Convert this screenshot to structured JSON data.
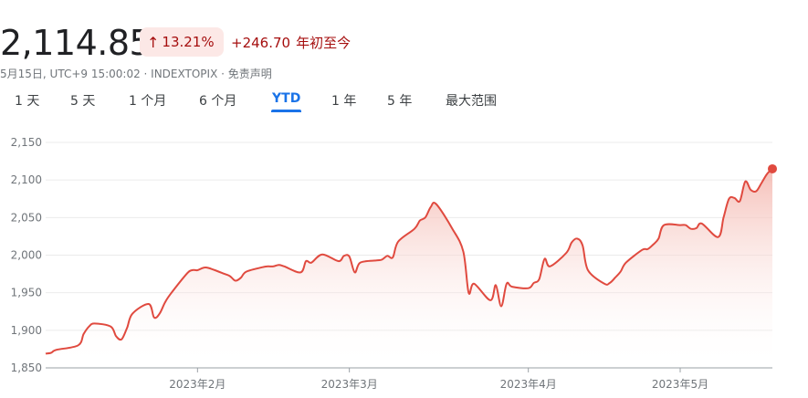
{
  "quote": {
    "price": "2,114.85",
    "percent_change": "13.21%",
    "abs_change": "+246.70",
    "period_label": "年初至今",
    "meta_text": "5月15日, UTC+9 15:00:02 · INDEXTOPIX · 免责声明",
    "up_arrow_icon": "arrow-up-icon"
  },
  "tabs": [
    {
      "label": "1 天"
    },
    {
      "label": "5 天"
    },
    {
      "label": "1 个月"
    },
    {
      "label": "6 个月"
    },
    {
      "label": "YTD",
      "active": true
    },
    {
      "label": "1 年"
    },
    {
      "label": "5 年"
    },
    {
      "label": "最大范围"
    }
  ],
  "colors": {
    "line": "#e04a3f",
    "fill_top": "#f4b8b0",
    "badge_bg": "#fce8e6",
    "negative_text": "#a50e0e",
    "accent": "#1a73e8"
  },
  "chart_data": {
    "type": "area",
    "x_axis": "date",
    "ylim": [
      1850,
      2150
    ],
    "yticks": [
      {
        "value": 1850,
        "label": "1,850"
      },
      {
        "value": 1900,
        "label": "1,900"
      },
      {
        "value": 1950,
        "label": "1,950"
      },
      {
        "value": 2000,
        "label": "2,000"
      },
      {
        "value": 2050,
        "label": "2,050"
      },
      {
        "value": 2100,
        "label": "2,100"
      },
      {
        "value": 2150,
        "label": "2,150"
      }
    ],
    "xticks": [
      {
        "date": "2023-02-01",
        "label": "2023年2月"
      },
      {
        "date": "2023-03-01",
        "label": "2023年3月"
      },
      {
        "date": "2023-04-03",
        "label": "2023年4月"
      },
      {
        "date": "2023-05-01",
        "label": "2023年5月"
      }
    ],
    "grid": "horizontal",
    "end_marker": true,
    "series": [
      {
        "points": [
          [
            "2023-01-04",
            1869
          ],
          [
            "2023-01-05",
            1870
          ],
          [
            "2023-01-06",
            1874
          ],
          [
            "2023-01-10",
            1880
          ],
          [
            "2023-01-11",
            1895
          ],
          [
            "2023-01-12",
            1905
          ],
          [
            "2023-01-13",
            1909
          ],
          [
            "2023-01-16",
            1905
          ],
          [
            "2023-01-17",
            1892
          ],
          [
            "2023-01-18",
            1888
          ],
          [
            "2023-01-19",
            1903
          ],
          [
            "2023-01-20",
            1922
          ],
          [
            "2023-01-23",
            1935
          ],
          [
            "2023-01-24",
            1917
          ],
          [
            "2023-01-25",
            1922
          ],
          [
            "2023-01-26",
            1937
          ],
          [
            "2023-01-27",
            1948
          ],
          [
            "2023-01-30",
            1975
          ],
          [
            "2023-01-31",
            1980
          ],
          [
            "2023-02-01",
            1980
          ],
          [
            "2023-02-02",
            1983
          ],
          [
            "2023-02-03",
            1983
          ],
          [
            "2023-02-06",
            1975
          ],
          [
            "2023-02-07",
            1972
          ],
          [
            "2023-02-08",
            1966
          ],
          [
            "2023-02-09",
            1970
          ],
          [
            "2023-02-10",
            1978
          ],
          [
            "2023-02-13",
            1984
          ],
          [
            "2023-02-14",
            1985
          ],
          [
            "2023-02-15",
            1985
          ],
          [
            "2023-02-16",
            1987
          ],
          [
            "2023-02-17",
            1985
          ],
          [
            "2023-02-20",
            1977
          ],
          [
            "2023-02-21",
            1992
          ],
          [
            "2023-02-22",
            1990
          ],
          [
            "2023-02-24",
            2001
          ],
          [
            "2023-02-27",
            1992
          ],
          [
            "2023-02-28",
            1999
          ],
          [
            "2023-03-01",
            1998
          ],
          [
            "2023-03-02",
            1977
          ],
          [
            "2023-03-03",
            1990
          ],
          [
            "2023-03-06",
            1993
          ],
          [
            "2023-03-07",
            1994
          ],
          [
            "2023-03-08",
            1999
          ],
          [
            "2023-03-09",
            1997
          ],
          [
            "2023-03-10",
            2018
          ],
          [
            "2023-03-13",
            2035
          ],
          [
            "2023-03-14",
            2046
          ],
          [
            "2023-03-15",
            2050
          ],
          [
            "2023-03-16",
            2064
          ],
          [
            "2023-03-17",
            2068
          ],
          [
            "2023-03-20",
            2035
          ],
          [
            "2023-03-22",
            2005
          ],
          [
            "2023-03-23",
            1950
          ],
          [
            "2023-03-24",
            1962
          ],
          [
            "2023-03-27",
            1940
          ],
          [
            "2023-03-28",
            1960
          ],
          [
            "2023-03-29",
            1932
          ],
          [
            "2023-03-30",
            1962
          ],
          [
            "2023-03-31",
            1958
          ],
          [
            "2023-04-03",
            1956
          ],
          [
            "2023-04-04",
            1963
          ],
          [
            "2023-04-05",
            1968
          ],
          [
            "2023-04-06",
            1995
          ],
          [
            "2023-04-07",
            1985
          ],
          [
            "2023-04-10",
            2003
          ],
          [
            "2023-04-11",
            2017
          ],
          [
            "2023-04-12",
            2022
          ],
          [
            "2023-04-13",
            2013
          ],
          [
            "2023-04-14",
            1980
          ],
          [
            "2023-04-17",
            1962
          ],
          [
            "2023-04-18",
            1963
          ],
          [
            "2023-04-19",
            1970
          ],
          [
            "2023-04-20",
            1978
          ],
          [
            "2023-04-21",
            1990
          ],
          [
            "2023-04-24",
            2007
          ],
          [
            "2023-04-25",
            2008
          ],
          [
            "2023-04-26",
            2014
          ],
          [
            "2023-04-27",
            2022
          ],
          [
            "2023-04-28",
            2040
          ],
          [
            "2023-05-01",
            2040
          ],
          [
            "2023-05-02",
            2040
          ],
          [
            "2023-05-03",
            2035
          ],
          [
            "2023-05-04",
            2036
          ],
          [
            "2023-05-05",
            2042
          ],
          [
            "2023-05-08",
            2024
          ],
          [
            "2023-05-09",
            2050
          ],
          [
            "2023-05-10",
            2075
          ],
          [
            "2023-05-11",
            2076
          ],
          [
            "2023-05-12",
            2072
          ],
          [
            "2023-05-13",
            2098
          ],
          [
            "2023-05-14",
            2087
          ],
          [
            "2023-05-15",
            2085
          ],
          [
            "2023-05-16",
            2096
          ],
          [
            "2023-05-17",
            2108
          ],
          [
            "2023-05-18",
            2114.85
          ]
        ]
      }
    ]
  }
}
